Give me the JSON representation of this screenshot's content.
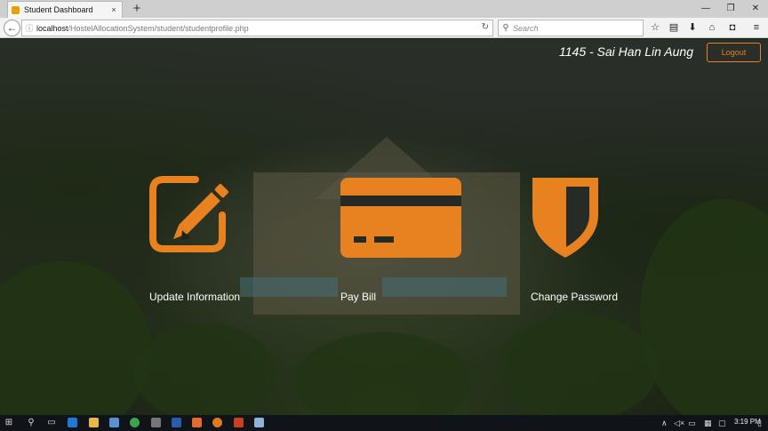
{
  "browser": {
    "tab_title": "Student Dashboard",
    "tab_close": "×",
    "new_tab": "+",
    "url_info": "ⓘ",
    "url_host": "localhost",
    "url_path": "/HostelAllocationSystem/student/studentprofile.php",
    "search_placeholder": "Search"
  },
  "header": {
    "user_label": "1145 - Sai Han Lin Aung",
    "logout_label": "Logout"
  },
  "actions": [
    {
      "label": "Update Information",
      "icon": "edit-icon"
    },
    {
      "label": "Pay Bill",
      "icon": "credit-card-icon"
    },
    {
      "label": "Change Password",
      "icon": "shield-icon"
    }
  ],
  "taskbar": {
    "clock": "3:19 PM"
  },
  "colors": {
    "accent": "#e8811f",
    "text": "#ffffff"
  }
}
